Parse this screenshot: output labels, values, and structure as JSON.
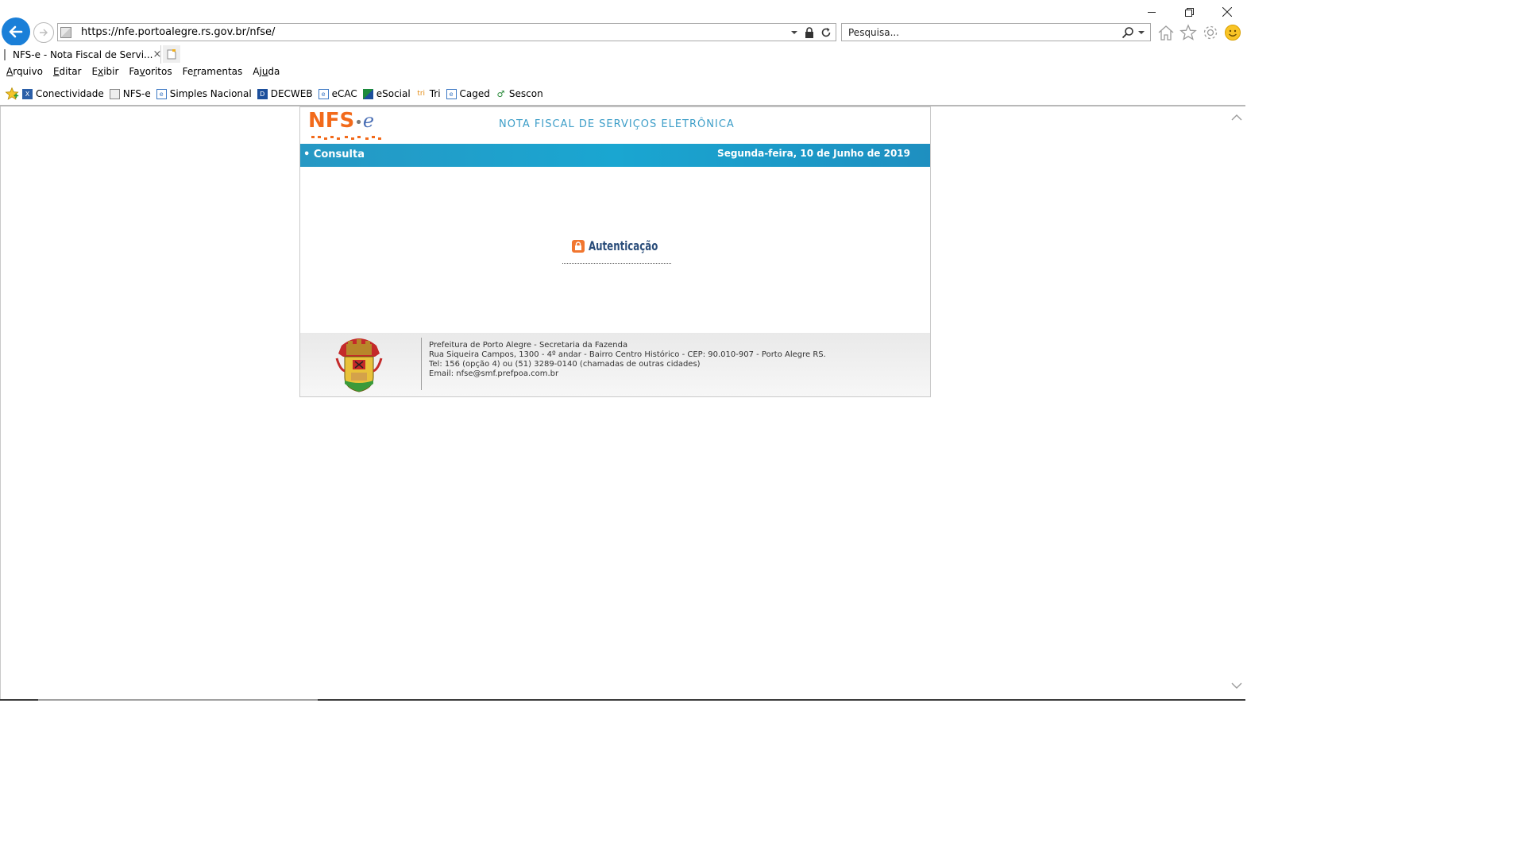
{
  "browser": {
    "url": "https://nfe.portoalegre.rs.gov.br/nfse/",
    "search_placeholder": "Pesquisa...",
    "tab_title": "NFS-e - Nota Fiscal de Servi...",
    "tab_close": "×"
  },
  "menu": [
    {
      "pre": "",
      "key": "A",
      "post": "rquivo"
    },
    {
      "pre": "",
      "key": "E",
      "post": "ditar"
    },
    {
      "pre": "E",
      "key": "x",
      "post": "ibir"
    },
    {
      "pre": "Fa",
      "key": "v",
      "post": "oritos"
    },
    {
      "pre": "Fe",
      "key": "r",
      "post": "ramentas"
    },
    {
      "pre": "Aj",
      "key": "u",
      "post": "da"
    }
  ],
  "favorites": [
    {
      "label": "Conectividade",
      "icon": "conectividade-icon"
    },
    {
      "label": "NFS-e",
      "icon": "page-icon"
    },
    {
      "label": "Simples Nacional",
      "icon": "ie-page-icon"
    },
    {
      "label": "DECWEB",
      "icon": "decweb-icon"
    },
    {
      "label": "eCAC",
      "icon": "ie-page-icon"
    },
    {
      "label": "eSocial",
      "icon": "esocial-icon"
    },
    {
      "label": "Tri",
      "icon": "tri-icon"
    },
    {
      "label": "Caged",
      "icon": "ie-page-icon"
    },
    {
      "label": "Sescon",
      "icon": "sescon-icon"
    }
  ],
  "page": {
    "logo_main": "NFS",
    "logo_dot": "•",
    "logo_e": "e",
    "header_title": "NOTA FISCAL DE SERVIÇOS ELETRÔNICA",
    "nav_consulta": "• Consulta",
    "date": "Segunda-feira, 10 de Junho de 2019",
    "auth_title": "Autenticação",
    "footer_lines": [
      "Prefeitura de Porto Alegre - Secretaria da Fazenda",
      "Rua Siqueira Campos, 1300 - 4º andar - Bairro Centro Histórico - CEP: 90.010-907 - Porto Alegre RS.",
      "Tel: 156 (opção 4) ou (51) 3289-0140 (chamadas de outras cidades)",
      "Email: nfse@smf.prefpoa.com.br"
    ]
  },
  "colors": {
    "accent_blue": "#1a7fd8",
    "bar_blue": "#1aa6d1",
    "logo_orange": "#f26a1b",
    "title_blue": "#3d9ec8"
  }
}
